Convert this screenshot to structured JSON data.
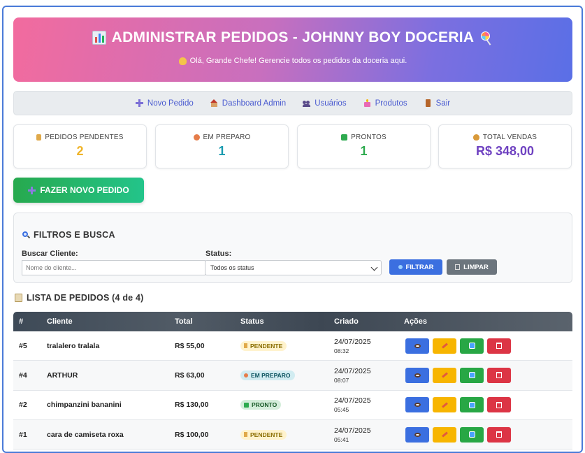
{
  "header": {
    "title": "ADMINISTRAR PEDIDOS - JOHNNY BOY DOCERIA",
    "subtitle": "Olá, Grande Chefe! Gerencie todos os pedidos da doceria aqui."
  },
  "nav": {
    "items": [
      {
        "label": "Novo Pedido",
        "icon": "plus-icon"
      },
      {
        "label": "Dashboard Admin",
        "icon": "house-icon"
      },
      {
        "label": "Usuários",
        "icon": "users-icon"
      },
      {
        "label": "Produtos",
        "icon": "cake-icon"
      },
      {
        "label": "Sair",
        "icon": "door-icon"
      }
    ]
  },
  "stats": [
    {
      "label": "PEDIDOS PENDENTES",
      "value": "2",
      "color": "#f0b429",
      "icon": "hourglass-icon"
    },
    {
      "label": "EM PREPARO",
      "value": "1",
      "color": "#1a9bb0",
      "icon": "cook-icon"
    },
    {
      "label": "PRONTOS",
      "value": "1",
      "color": "#2eaa4f",
      "icon": "check-icon"
    },
    {
      "label": "TOTAL VENDAS",
      "value": "R$ 348,00",
      "color": "#6f42c1",
      "icon": "money-bag-icon"
    }
  ],
  "new_order_button": "FAZER NOVO PEDIDO",
  "filters": {
    "title": "FILTROS E BUSCA",
    "client_label": "Buscar Cliente:",
    "client_placeholder": "Nome do cliente...",
    "status_label": "Status:",
    "status_value": "Todos os status",
    "filter_button": "FILTRAR",
    "clear_button": "LIMPAR"
  },
  "list": {
    "title": "LISTA DE PEDIDOS (4 de 4)",
    "columns": [
      "#",
      "Cliente",
      "Total",
      "Status",
      "Criado",
      "Ações"
    ],
    "rows": [
      {
        "id": "#5",
        "client": "tralalero tralala",
        "total": "R$ 55,00",
        "status": "PENDENTE",
        "date": "24/07/2025",
        "time": "08:32"
      },
      {
        "id": "#4",
        "client": "ARTHUR",
        "total": "R$ 63,00",
        "status": "EM PREPARO",
        "date": "24/07/2025",
        "time": "08:07"
      },
      {
        "id": "#2",
        "client": "chimpanzini bananini",
        "total": "R$ 130,00",
        "status": "PRONTO",
        "date": "24/07/2025",
        "time": "05:45"
      },
      {
        "id": "#1",
        "client": "cara de camiseta roxa",
        "total": "R$ 100,00",
        "status": "PENDENTE",
        "date": "24/07/2025",
        "time": "05:41"
      }
    ]
  },
  "colors": {
    "view": "#3b6fe0",
    "edit": "#f7b500",
    "status_change": "#28a745",
    "delete": "#dc3545",
    "pending_bg": "#fff3cd",
    "pending_fg": "#8a6d00",
    "preparing_bg": "#d1ecf1",
    "preparing_fg": "#0c5460",
    "ready_bg": "#d4edda",
    "ready_fg": "#155724"
  }
}
